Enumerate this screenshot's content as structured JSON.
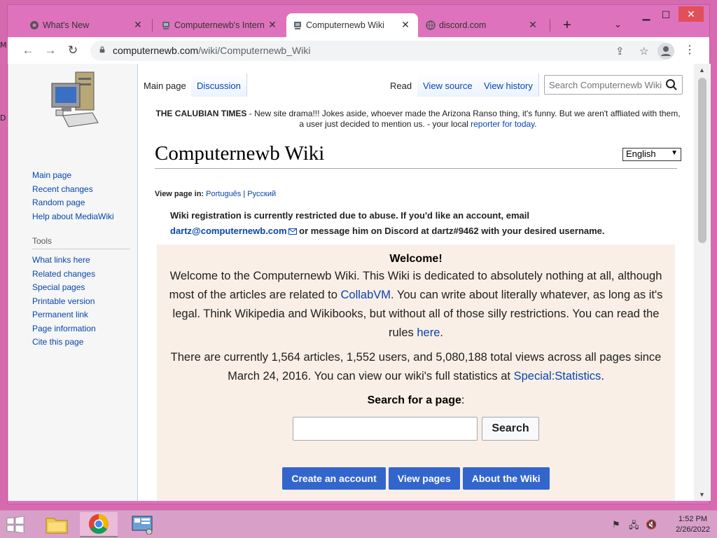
{
  "desktop": {
    "marks": [
      "M",
      "D"
    ]
  },
  "browser": {
    "tabs": [
      {
        "label": "What's New",
        "icon": "chrome-icon"
      },
      {
        "label": "Computernewb's Intern",
        "icon": "computernewb-icon"
      },
      {
        "label": "Computernewb Wiki",
        "icon": "computernewb-icon",
        "active": true
      },
      {
        "label": "discord.com",
        "icon": "globe-icon"
      }
    ],
    "new_tab": "+",
    "url_host": "computernewb.com",
    "url_path": "/wiki/Computernewb_Wiki"
  },
  "wiki": {
    "page_tabs": {
      "main": "Main page",
      "discussion": "Discussion",
      "read": "Read",
      "view_source": "View source",
      "view_history": "View history"
    },
    "search_placeholder": "Search Computernewb Wiki",
    "nav": [
      "Main page",
      "Recent changes",
      "Random page",
      "Help about MediaWiki"
    ],
    "tools_title": "Tools",
    "tools": [
      "What links here",
      "Related changes",
      "Special pages",
      "Printable version",
      "Permanent link",
      "Page information",
      "Cite this page"
    ],
    "notice": {
      "bold": "THE CALUBIAN TIMES",
      "text": " - New site drama!!! Jokes aside, whoever made the Arizona Ranso thing, it's funny. But we aren't affliated with them, a user just decided to mention us. - your local ",
      "link": "reporter for today",
      "end": "."
    },
    "title": "Computernewb Wiki",
    "language": "English",
    "view_in": {
      "label": "View page in:",
      "lang1": "Português",
      "sep": "|",
      "lang2": "Русский"
    },
    "restriction": {
      "pre": "Wiki registration is currently restricted due to abuse. If you'd like an account, email",
      "email": "dartz@computernewb.com",
      "post": " or message him on Discord at dartz#9462 with your desired username."
    },
    "welcome": {
      "title": "Welcome!",
      "p1_a": "Welcome to the Computernewb Wiki. This Wiki is dedicated to absolutely nothing at all, although most of the articles are related to ",
      "p1_link": "CollabVM",
      "p1_b": ". You can write about literally whatever, as long as it's legal. Think Wikipedia and Wikibooks, but without all of those silly restrictions. You can read the rules ",
      "p1_link2": "here",
      "p1_c": ".",
      "p2_a": "There are currently 1,564 articles, 1,552 users, and 5,080,188 total views across all pages since March 24, 2016. You can view our wiki's full statistics at ",
      "p2_link": "Special:Statistics",
      "p2_b": ".",
      "search_label": "Search for a page",
      "search_colon": ":",
      "search_button": "Search",
      "buttons": [
        "Create an account",
        "View pages",
        "About the Wiki"
      ]
    }
  },
  "taskbar": {
    "time": "1:52 PM",
    "date": "2/26/2022"
  }
}
